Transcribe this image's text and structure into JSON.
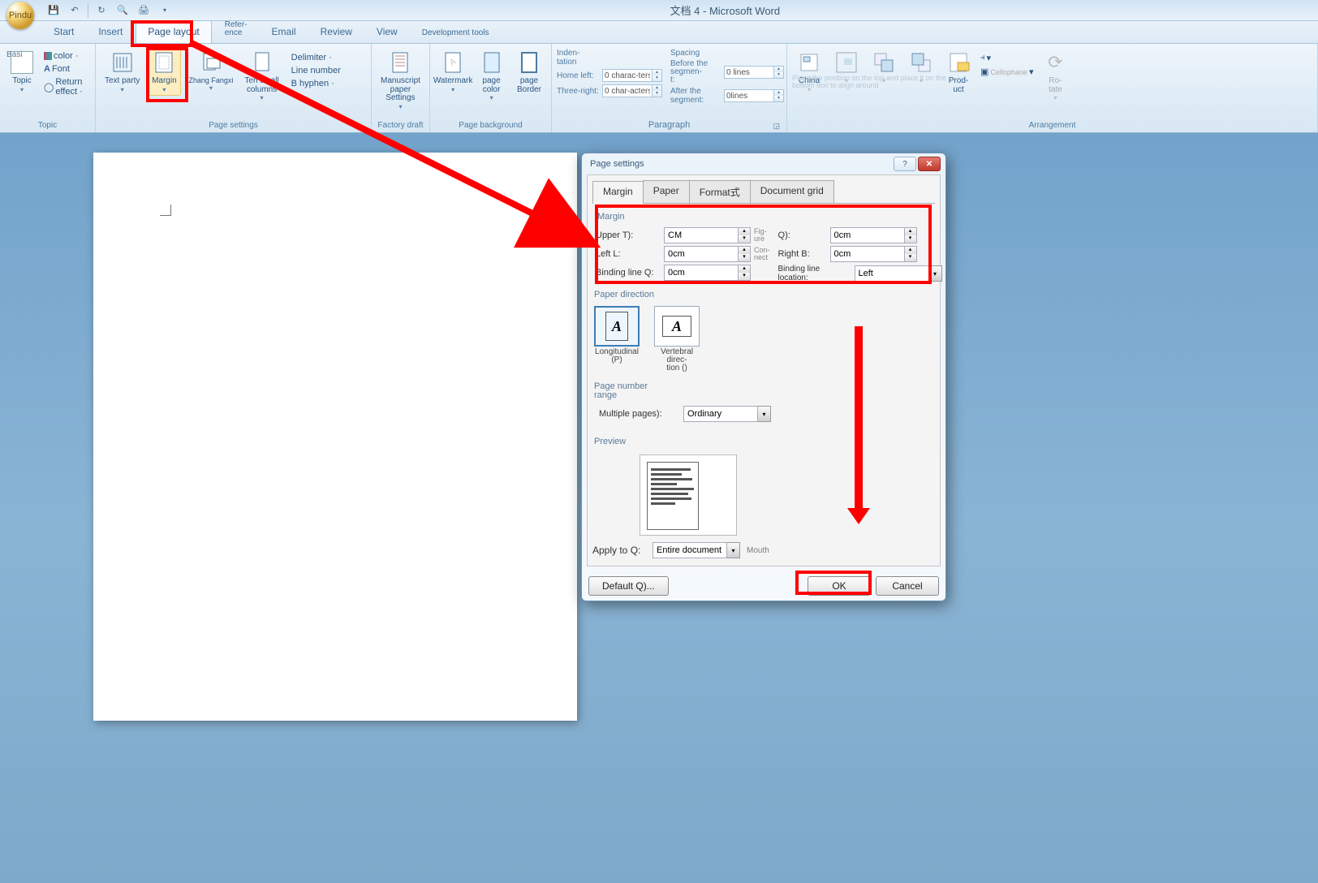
{
  "window_title": "文档 4 - Microsoft Word",
  "orb_label": "Pindu",
  "qat": [
    "save-icon",
    "undo-icon",
    "redo-icon",
    "print-preview-icon",
    "quick-print-icon"
  ],
  "tabs": [
    {
      "id": "start",
      "label": "Start"
    },
    {
      "id": "insert",
      "label": "Insert"
    },
    {
      "id": "pagelayout",
      "label": "Page layout",
      "active": true
    },
    {
      "id": "reference",
      "label": "Refer-\nence"
    },
    {
      "id": "email",
      "label": "Email"
    },
    {
      "id": "review",
      "label": "Review"
    },
    {
      "id": "view",
      "label": "View"
    },
    {
      "id": "dev",
      "label": "Development tools"
    }
  ],
  "ribbon": {
    "topic": {
      "label": "Topic",
      "btn": "Topic",
      "basi": "Basi",
      "items": [
        "color ·",
        "Font",
        "Return effect ·"
      ]
    },
    "pageset": {
      "label": "Page settings",
      "items": [
        {
          "id": "textdir",
          "label": "Text party"
        },
        {
          "id": "margin",
          "label": "Margin",
          "hl": true
        },
        {
          "id": "pagedir",
          "label": "Zhang Fangxi"
        },
        {
          "id": "size",
          "label": "Ten small\ncolumns"
        },
        {
          "id": "cols",
          "label": ""
        }
      ],
      "mini": [
        "Delimiter ·",
        "Line number",
        "B hyphen ·"
      ]
    },
    "factory": {
      "label": "Factory draft",
      "items": [
        {
          "id": "manu",
          "label": "Manuscript\npaper\nSettings"
        }
      ]
    },
    "bg": {
      "label": "Page background",
      "items": [
        {
          "id": "wm",
          "label": "Watermark"
        },
        {
          "id": "pc",
          "label": "page color"
        },
        {
          "id": "pb",
          "label": "page\nBorder"
        }
      ]
    },
    "para": {
      "label": "Paragraph",
      "indent": {
        "title": "Inden-\ntation",
        "l": "Home left:",
        "lval": "0 charac-\nters",
        "r": "Three-right:",
        "rval": "0 char-\nacters"
      },
      "spacing": {
        "title": "Spacing",
        "b": "Before the segmen-\nt:",
        "bval": "0 lines",
        "a": "After the segment:",
        "aval": "0\nlines"
      }
    },
    "arrange": {
      "label": "Arrangement",
      "hint": "Place the position on the top and place it on the bottom text to align around",
      "items": [
        {
          "id": "pos",
          "label": "China"
        },
        {
          "id": "wrap",
          "label": ""
        },
        {
          "id": "front",
          "label": ""
        },
        {
          "id": "back",
          "label": ""
        },
        {
          "id": "pane",
          "label": "Prod-\nuct"
        },
        {
          "id": "align",
          "label": ""
        },
        {
          "id": "group",
          "label": "Cellophane"
        },
        {
          "id": "rotate",
          "label": "Ro-\ntate"
        }
      ]
    }
  },
  "dialog": {
    "title": "Page settings",
    "tabs": [
      "Margin",
      "Paper",
      "Format式",
      "Document grid"
    ],
    "active_tab": 0,
    "margin": {
      "heading": "Margin",
      "upper": {
        "lab": "Upper T):",
        "val": "CM",
        "extra": "Fig-\nure"
      },
      "lower": {
        "lab": "Q):",
        "val": "0cm"
      },
      "left": {
        "lab": "Left L:",
        "val": "0cm",
        "extra": "Con-\nnect"
      },
      "right": {
        "lab": "Right B:",
        "val": "0cm"
      },
      "gutter": {
        "lab": "Binding line Q:",
        "val": "0cm"
      },
      "gutterpos": {
        "lab": "Binding line location:",
        "val": "Left"
      }
    },
    "orientation": {
      "heading": "Paper direction",
      "portrait": "Longitudinal (P)",
      "landscape": "Vertebral direc-\ntion ()"
    },
    "pagerange": {
      "heading": "Page number\nrange",
      "multi_lab": "Multiple pages):",
      "multi_val": "Ordinary"
    },
    "preview": "Preview",
    "apply": {
      "lab": "Apply to Q:",
      "val": "Entire document",
      "extra": "Mouth"
    },
    "default_btn": "Default Q)...",
    "ok": "OK",
    "cancel": "Cancel"
  }
}
